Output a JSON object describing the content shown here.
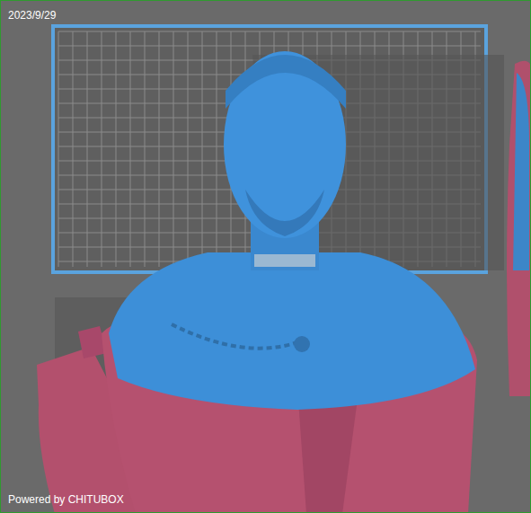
{
  "viewport": {
    "date": "2023/9/29",
    "watermark": "Powered by CHITUBOX"
  }
}
